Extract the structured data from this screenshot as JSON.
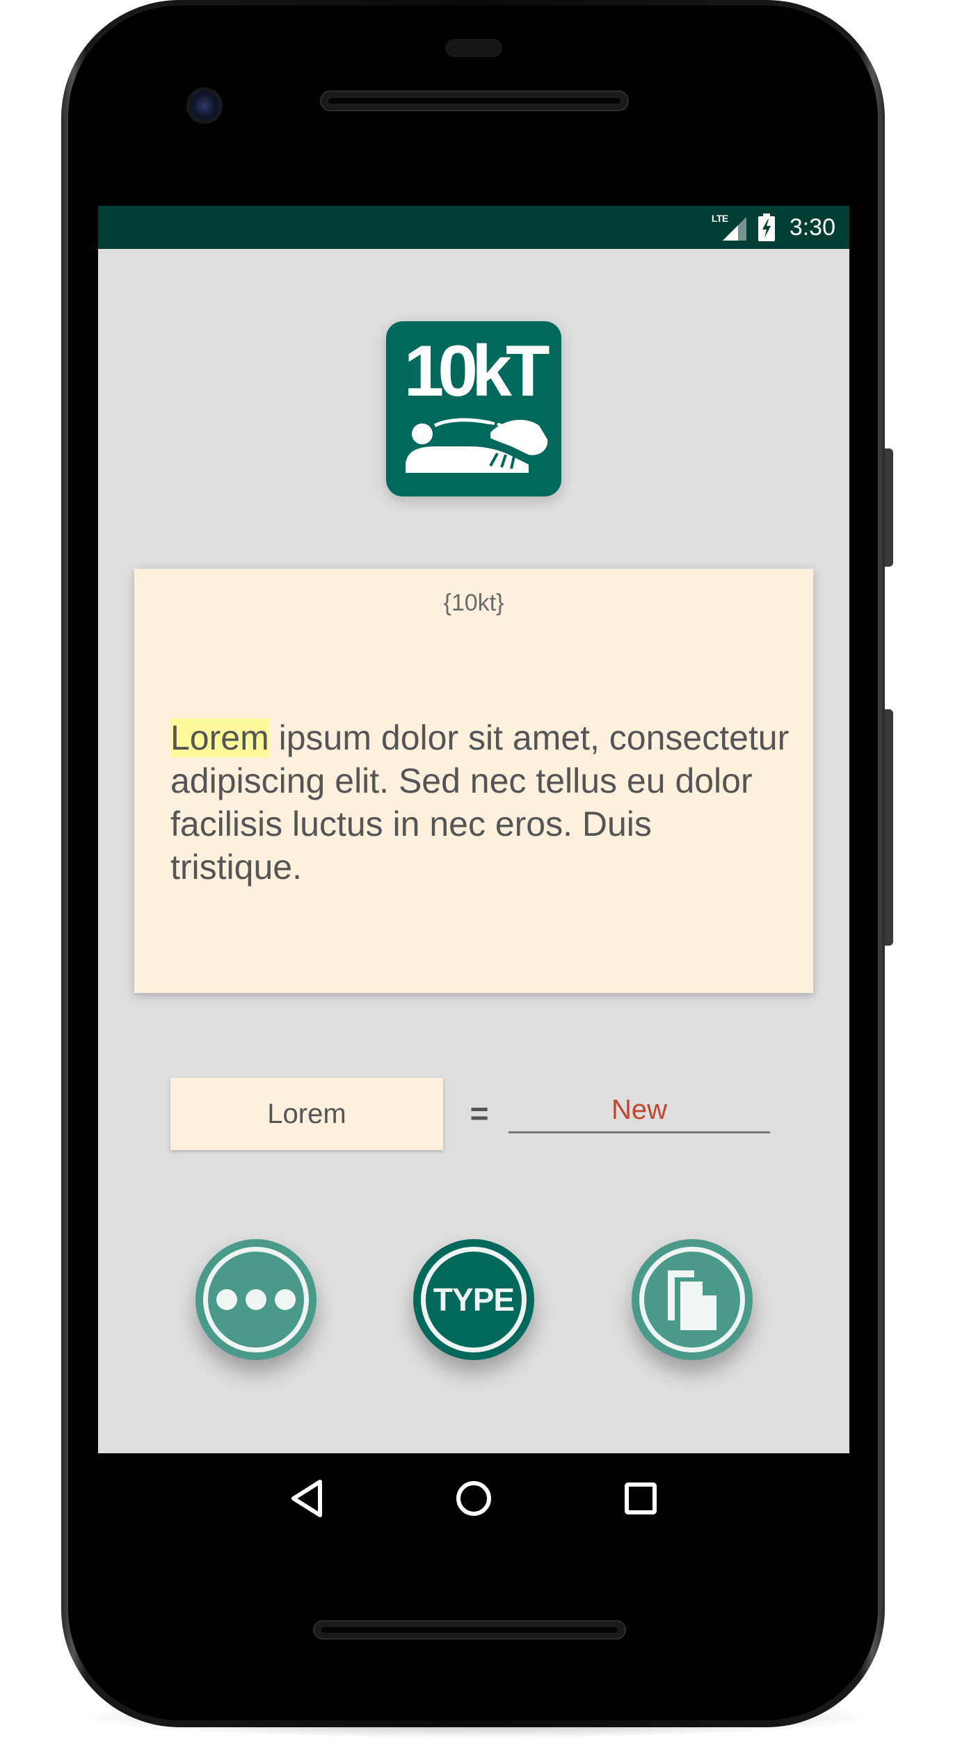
{
  "status_bar": {
    "network": "LTE",
    "time": "3:30",
    "background_color": "#003d33",
    "icons": [
      "signal-icon",
      "battery-charging-icon"
    ]
  },
  "logo": {
    "text": "10kT",
    "background_color": "#00695c",
    "icon": "typing-hand-icon"
  },
  "card": {
    "tag": "{10kt}",
    "highlighted_word": "Lorem",
    "text_rest": " ipsum dolor sit amet, consectetur adipiscing elit. Sed nec tellus eu dolor facilisis luctus in nec eros. Duis tristique.",
    "background_color": "#fdf0dd",
    "highlight_color": "#fbf99a"
  },
  "word_row": {
    "source_word": "Lorem",
    "equals": "=",
    "target_value": "New",
    "target_color": "#c0462f"
  },
  "actions": {
    "more_icon": "more-horizontal-icon",
    "type_label": "TYPE",
    "copy_icon": "copy-icon"
  },
  "nav": {
    "back_icon": "back-icon",
    "home_icon": "home-icon",
    "recents_icon": "recents-icon"
  }
}
